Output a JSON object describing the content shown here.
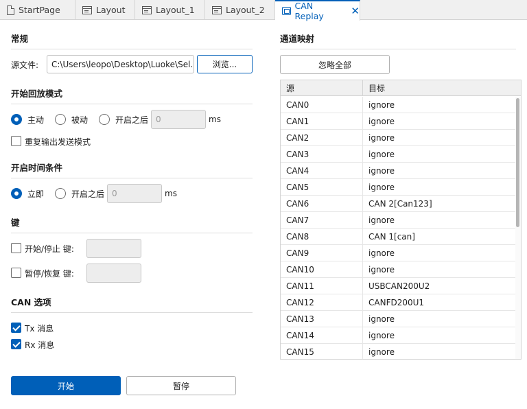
{
  "tabs": [
    {
      "label": "StartPage",
      "icon": "page-icon"
    },
    {
      "label": "Layout",
      "icon": "window-icon"
    },
    {
      "label": "Layout_1",
      "icon": "window-icon"
    },
    {
      "label": "Layout_2",
      "icon": "window-icon"
    },
    {
      "label": "CAN Replay",
      "icon": "replay-icon",
      "close": "✕"
    }
  ],
  "general": {
    "heading": "常规",
    "source_label": "源文件:",
    "source_value": "C:\\Users\\leopo\\Desktop\\Luoke\\Sel...",
    "browse_label": "浏览..."
  },
  "start_mode": {
    "heading": "开始回放模式",
    "active_label": "主动",
    "passive_label": "被动",
    "after_label": "开启之后",
    "after_value": "0",
    "unit": "ms",
    "repeat_label": "重复输出发送模式"
  },
  "start_time": {
    "heading": "开启时间条件",
    "immediate_label": "立即",
    "after_label": "开启之后",
    "after_value": "0",
    "unit": "ms"
  },
  "keys": {
    "heading": "键",
    "start_stop_label": "开始/停止 键:",
    "pause_resume_label": "暂停/恢复 键:"
  },
  "can_options": {
    "heading": "CAN 选项",
    "tx_label": "Tx 消息",
    "rx_label": "Rx 消息"
  },
  "actions": {
    "start_label": "开始",
    "pause_label": "暂停"
  },
  "mapping": {
    "heading": "通道映射",
    "ignore_all_label": "忽略全部",
    "col_source": "源",
    "col_target": "目标",
    "rows": [
      {
        "source": "CAN0",
        "target": "ignore"
      },
      {
        "source": "CAN1",
        "target": "ignore"
      },
      {
        "source": "CAN2",
        "target": "ignore"
      },
      {
        "source": "CAN3",
        "target": "ignore"
      },
      {
        "source": "CAN4",
        "target": "ignore"
      },
      {
        "source": "CAN5",
        "target": "ignore"
      },
      {
        "source": "CAN6",
        "target": "CAN 2[Can123]"
      },
      {
        "source": "CAN7",
        "target": "ignore"
      },
      {
        "source": "CAN8",
        "target": "CAN 1[can]"
      },
      {
        "source": "CAN9",
        "target": "ignore"
      },
      {
        "source": "CAN10",
        "target": "ignore"
      },
      {
        "source": "CAN11",
        "target": "USBCAN200U2"
      },
      {
        "source": "CAN12",
        "target": "CANFD200U1"
      },
      {
        "source": "CAN13",
        "target": "ignore"
      },
      {
        "source": "CAN14",
        "target": "ignore"
      },
      {
        "source": "CAN15",
        "target": "ignore"
      }
    ]
  },
  "colors": {
    "accent": "#005fb8",
    "tab_bar": "#f0f0f0"
  }
}
